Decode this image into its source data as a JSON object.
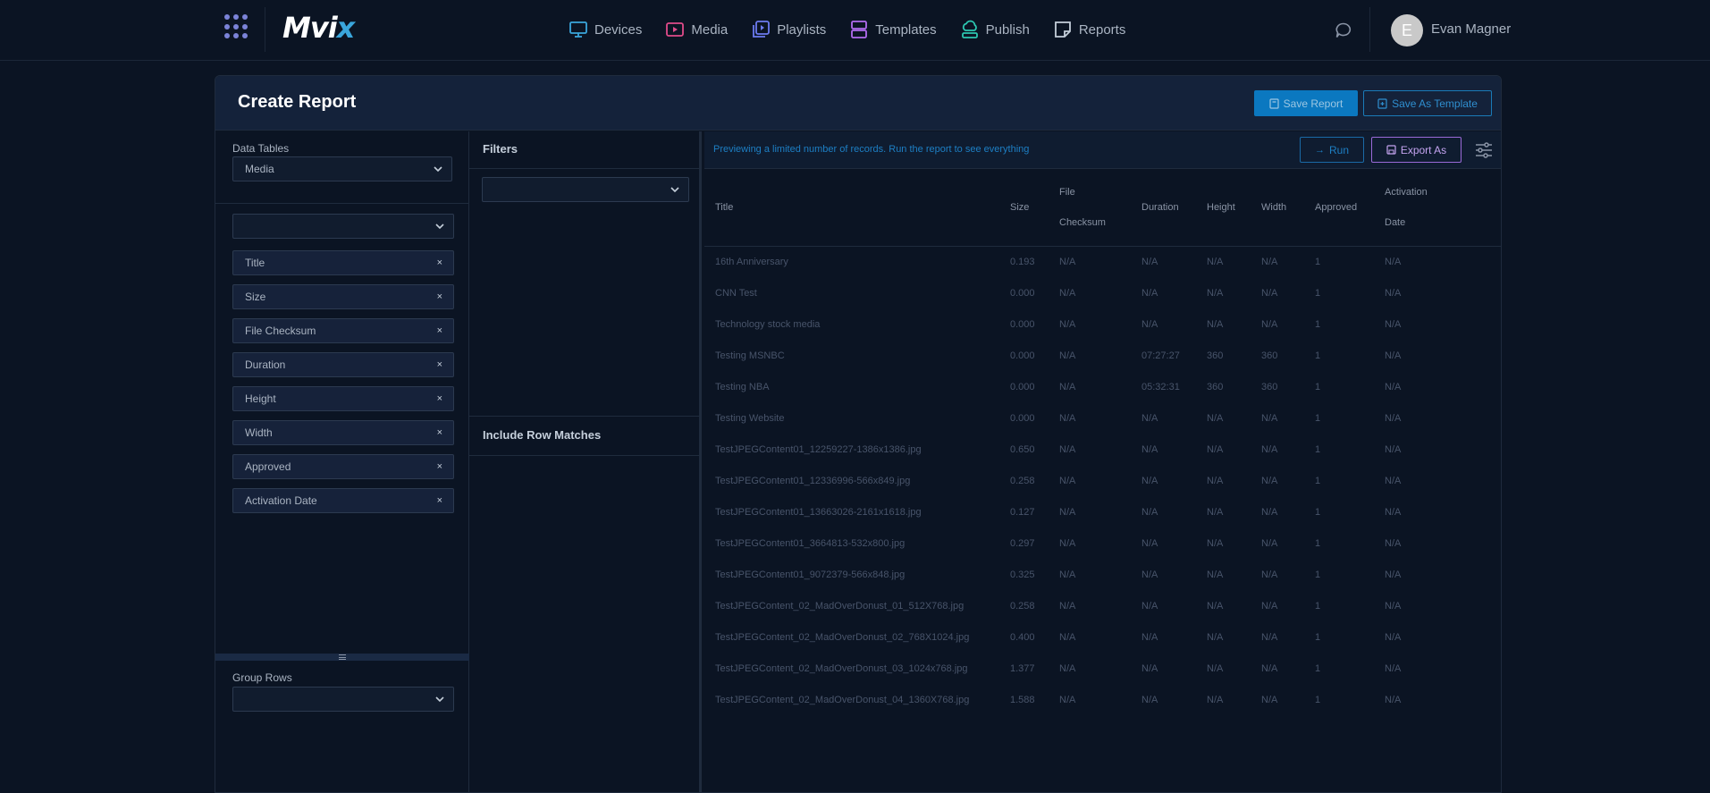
{
  "app": {
    "logo_main": "Mvi",
    "logo_accent": "x",
    "nav": [
      {
        "label": "Devices",
        "icon": "monitor-icon",
        "color": "#3aa6dc"
      },
      {
        "label": "Media",
        "icon": "play-media-icon",
        "color": "#e14b8a"
      },
      {
        "label": "Playlists",
        "icon": "playlist-icon",
        "color": "#6c7bf0"
      },
      {
        "label": "Templates",
        "icon": "template-icon",
        "color": "#b26cf0"
      },
      {
        "label": "Publish",
        "icon": "cloud-publish-icon",
        "color": "#2cc6b0"
      },
      {
        "label": "Reports",
        "icon": "report-icon",
        "color": "#c5cfdb"
      }
    ],
    "user": {
      "initial": "E",
      "name": "Evan Magner"
    }
  },
  "page": {
    "title": "Create Report",
    "save_label": "Save Report",
    "save_template_label": "Save As Template"
  },
  "left": {
    "data_tables_label": "Data Tables",
    "data_tables_value": "Media",
    "columns_select_value": "",
    "columns": [
      "Title",
      "Size",
      "File Checksum",
      "Duration",
      "Height",
      "Width",
      "Approved",
      "Activation Date"
    ],
    "chip_remove": "×",
    "group_rows_label": "Group Rows",
    "group_rows_value": ""
  },
  "middle": {
    "filters_title": "Filters",
    "filters_value": "",
    "include_title": "Include Row Matches"
  },
  "right": {
    "preview_note": "Previewing a limited number of records. Run the report to see everything",
    "run_label": "Run",
    "export_label": "Export As",
    "headers": [
      {
        "l1": "Title",
        "l2": ""
      },
      {
        "l1": "Size",
        "l2": ""
      },
      {
        "l1": "File",
        "l2": "Checksum"
      },
      {
        "l1": "Duration",
        "l2": ""
      },
      {
        "l1": "Height",
        "l2": ""
      },
      {
        "l1": "Width",
        "l2": ""
      },
      {
        "l1": "Approved",
        "l2": ""
      },
      {
        "l1": "Activation",
        "l2": "Date"
      }
    ],
    "rows": [
      [
        "16th Anniversary",
        "0.193",
        "N/A",
        "N/A",
        "N/A",
        "N/A",
        "1",
        "N/A"
      ],
      [
        "CNN Test",
        "0.000",
        "N/A",
        "N/A",
        "N/A",
        "N/A",
        "1",
        "N/A"
      ],
      [
        "Technology stock media",
        "0.000",
        "N/A",
        "N/A",
        "N/A",
        "N/A",
        "1",
        "N/A"
      ],
      [
        "Testing MSNBC",
        "0.000",
        "N/A",
        "07:27:27",
        "360",
        "360",
        "1",
        "N/A"
      ],
      [
        "Testing NBA",
        "0.000",
        "N/A",
        "05:32:31",
        "360",
        "360",
        "1",
        "N/A"
      ],
      [
        "Testing Website",
        "0.000",
        "N/A",
        "N/A",
        "N/A",
        "N/A",
        "1",
        "N/A"
      ],
      [
        "TestJPEGContent01_12259227-1386x1386.jpg",
        "0.650",
        "N/A",
        "N/A",
        "N/A",
        "N/A",
        "1",
        "N/A"
      ],
      [
        "TestJPEGContent01_12336996-566x849.jpg",
        "0.258",
        "N/A",
        "N/A",
        "N/A",
        "N/A",
        "1",
        "N/A"
      ],
      [
        "TestJPEGContent01_13663026-2161x1618.jpg",
        "0.127",
        "N/A",
        "N/A",
        "N/A",
        "N/A",
        "1",
        "N/A"
      ],
      [
        "TestJPEGContent01_3664813-532x800.jpg",
        "0.297",
        "N/A",
        "N/A",
        "N/A",
        "N/A",
        "1",
        "N/A"
      ],
      [
        "TestJPEGContent01_9072379-566x848.jpg",
        "0.325",
        "N/A",
        "N/A",
        "N/A",
        "N/A",
        "1",
        "N/A"
      ],
      [
        "TestJPEGContent_02_MadOverDonust_01_512X768.jpg",
        "0.258",
        "N/A",
        "N/A",
        "N/A",
        "N/A",
        "1",
        "N/A"
      ],
      [
        "TestJPEGContent_02_MadOverDonust_02_768X1024.jpg",
        "0.400",
        "N/A",
        "N/A",
        "N/A",
        "N/A",
        "1",
        "N/A"
      ],
      [
        "TestJPEGContent_02_MadOverDonust_03_1024x768.jpg",
        "1.377",
        "N/A",
        "N/A",
        "N/A",
        "N/A",
        "1",
        "N/A"
      ],
      [
        "TestJPEGContent_02_MadOverDonust_04_1360X768.jpg",
        "1.588",
        "N/A",
        "N/A",
        "N/A",
        "N/A",
        "1",
        "N/A"
      ]
    ]
  }
}
